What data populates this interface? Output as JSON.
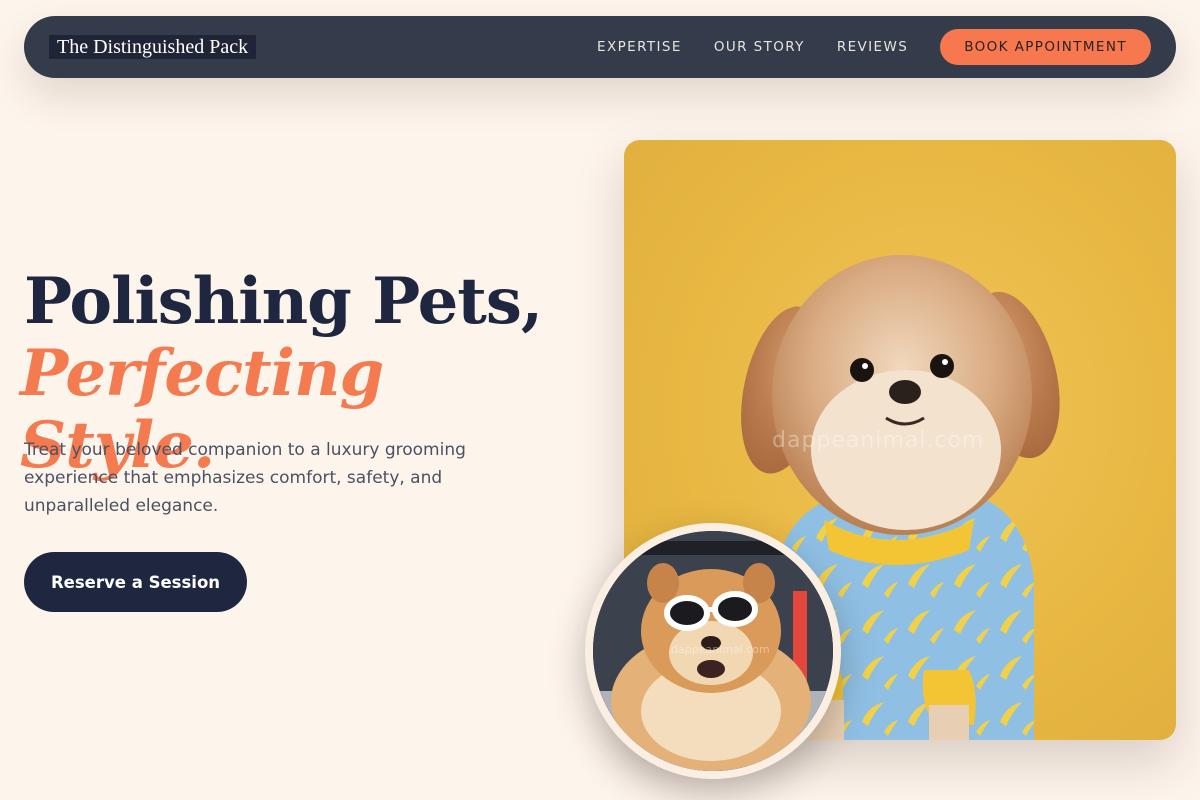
{
  "nav": {
    "brand": "The Distinguished Pack",
    "links": [
      "EXPERTISE",
      "OUR STORY",
      "REVIEWS"
    ],
    "cta": "BOOK APPOINTMENT"
  },
  "hero": {
    "title_line1": "Polishing Pets,",
    "title_line2": "Perfecting Style.",
    "description": "Treat your beloved companion to a luxury grooming experience that emphasizes comfort, safety, and unparalleled elegance.",
    "cta": "Reserve a Session"
  },
  "images": {
    "main_watermark": "dappeanimal.com",
    "inset_watermark": "dappeanimal.com"
  },
  "colors": {
    "background": "#fdf4ec",
    "nav_bg": "#343b4b",
    "accent": "#f7784e",
    "navy": "#1f2740"
  }
}
